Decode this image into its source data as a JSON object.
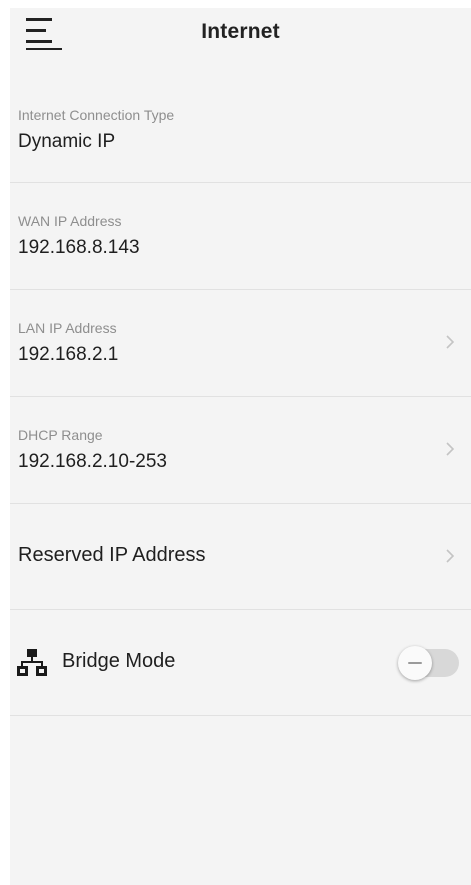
{
  "header": {
    "title": "Internet",
    "menu_icon": "hamburger-menu-icon"
  },
  "rows": [
    {
      "label": "Internet Connection Type",
      "value": "Dynamic IP"
    },
    {
      "label": "WAN IP Address",
      "value": "192.168.8.143"
    },
    {
      "label": "LAN IP Address",
      "value": "192.168.2.1",
      "icon": "chevron-right-icon"
    },
    {
      "label": "DHCP Range",
      "value": "192.168.2.10-253",
      "icon": "chevron-right-icon"
    },
    {
      "value": "Reserved IP Address",
      "icon": "chevron-right-icon"
    }
  ],
  "bridge": {
    "label": "Bridge Mode",
    "icon": "network-icon",
    "enabled": false
  },
  "colors": {
    "background": "#f4f4f4",
    "divider": "#e1e1e1",
    "label": "#8e8e8e",
    "text": "#1f1f1f"
  }
}
